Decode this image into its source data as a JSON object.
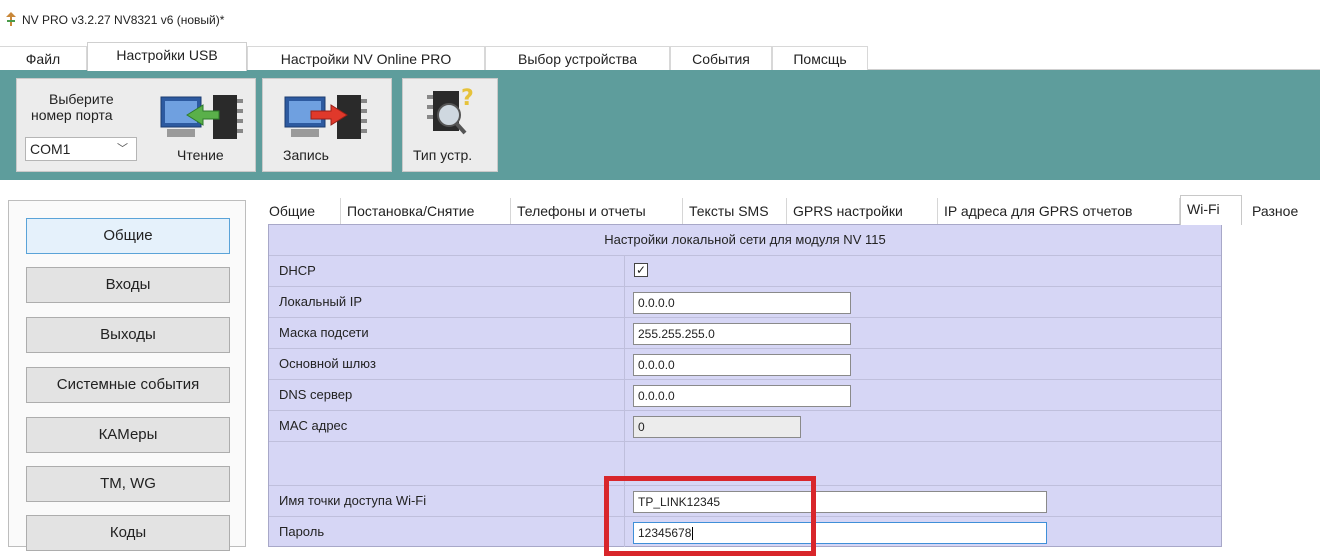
{
  "window": {
    "title": "NV PRO v3.2.27 NV8321 v6 (новый)*"
  },
  "menu": {
    "tabs": [
      {
        "label": "Файл"
      },
      {
        "label": "Настройки USB"
      },
      {
        "label": "Настройки NV Online PRO"
      },
      {
        "label": "Выбор устройства"
      },
      {
        "label": "События"
      },
      {
        "label": "Помсщь"
      }
    ],
    "active_index": 1
  },
  "ribbon": {
    "port_label_line1": "Выберите",
    "port_label_line2": "номер порта",
    "port_value": "COM1",
    "read_label": "Чтение",
    "write_label": "Запись",
    "type_label": "Тип устр."
  },
  "sidebar": {
    "items": [
      {
        "label": "Общие"
      },
      {
        "label": "Входы"
      },
      {
        "label": "Выходы"
      },
      {
        "label": "Системные события"
      },
      {
        "label": "КАМеры"
      },
      {
        "label": "TM, WG"
      },
      {
        "label": "Коды"
      }
    ],
    "active_index": 0
  },
  "tabs": {
    "items": [
      {
        "label": "Общие"
      },
      {
        "label": "Постановка/Снятие"
      },
      {
        "label": "Телефоны и отчеты"
      },
      {
        "label": "Тексты SMS"
      },
      {
        "label": "GPRS настройки"
      },
      {
        "label": "IP адреса для GPRS отчетов"
      },
      {
        "label": "Wi-Fi"
      },
      {
        "label": "Разное"
      }
    ],
    "active_index": 6
  },
  "wifi": {
    "header": "Настройки локальной сети для модуля NV 115",
    "dhcp_label": "DHCP",
    "dhcp_checked": true,
    "dhcp_mark": "✓",
    "local_ip_label": "Локальный IP",
    "local_ip": "0.0.0.0",
    "mask_label": "Маска подсети",
    "mask": "255.255.255.0",
    "gateway_label": "Основной шлюз",
    "gateway": "0.0.0.0",
    "dns_label": "DNS сервер",
    "dns": "0.0.0.0",
    "mac_label": "MAC адрес",
    "mac": "0",
    "ssid_label": "Имя точки доступа Wi-Fi",
    "ssid": "TP_LINK12345",
    "password_label": "Пароль",
    "password": "12345678"
  },
  "colors": {
    "ribbon_bg": "#5e9d9c",
    "grid_bg": "#d6d6f5",
    "highlight": "#d8262b",
    "active_nav_border": "#5aa3d8"
  }
}
